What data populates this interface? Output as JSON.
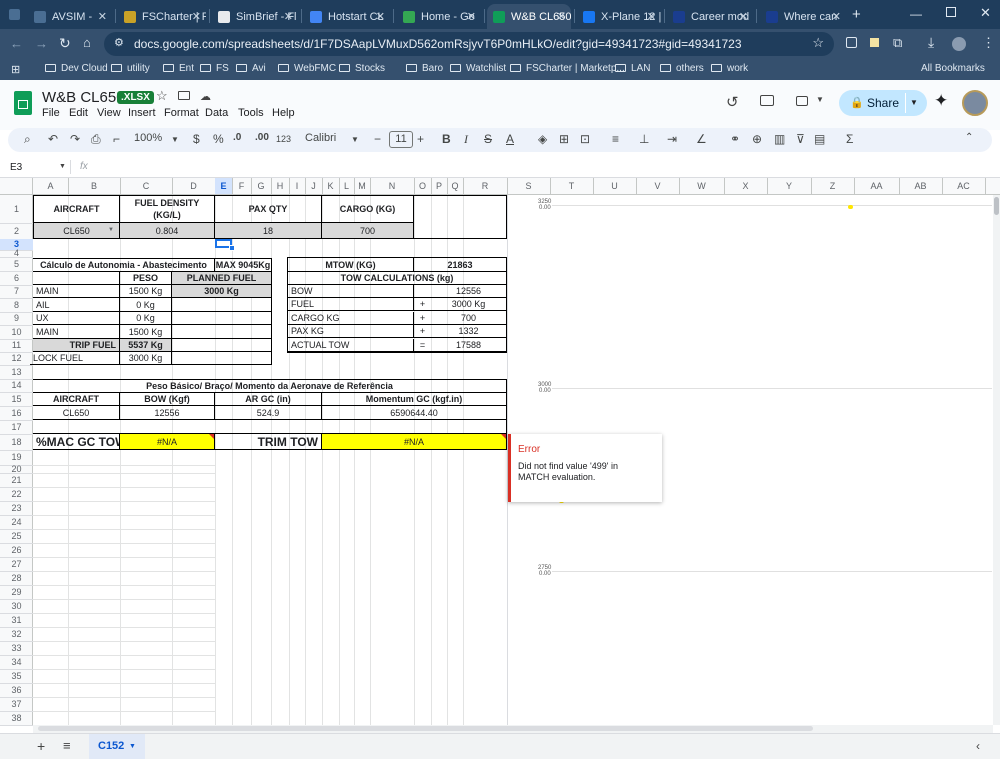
{
  "browser": {
    "tabs": [
      {
        "label": "AVSIM -",
        "color": "#4a6e93",
        "active": false
      },
      {
        "label": "FSCharter | F",
        "color": "#c9a227",
        "active": false
      },
      {
        "label": "SimBrief - Fl",
        "color": "#e8eaed",
        "active": false
      },
      {
        "label": "Hotstart CL",
        "color": "#4285f4",
        "active": false
      },
      {
        "label": "Home - Go",
        "color": "#34a853",
        "active": false
      },
      {
        "label": "W&B CL650",
        "color": "#0f9d58",
        "active": true
      },
      {
        "label": "X-Plane 12 |",
        "color": "#1877f2",
        "active": false
      },
      {
        "label": "Career mod",
        "color": "#1a3d8f",
        "active": false
      },
      {
        "label": "Where can",
        "color": "#1a3d8f",
        "active": false
      }
    ],
    "new_tab": "+",
    "url": "docs.google.com/spreadsheets/d/1F7DSAapLVMuxD562omRsjyvT6P0mHLkO/edit?gid=49341723#gid=49341723",
    "bookmarks": [
      "Dev Cloud",
      "utility",
      "Ent",
      "FS",
      "Avi",
      "WebFMC",
      "Stocks",
      "Baro",
      "Watchlist",
      "FSCharter | Marketp...",
      "LAN",
      "others",
      "work"
    ],
    "all_bookmarks": "All Bookmarks"
  },
  "app": {
    "doc_title": "W&B CL650",
    "badge": ".XLSX",
    "menu": [
      "File",
      "Edit",
      "View",
      "Insert",
      "Format",
      "Data",
      "Tools",
      "Help"
    ],
    "share": "Share"
  },
  "toolbar": {
    "zoom": "100%",
    "currency": "$",
    "percent": "%",
    "dec_less": ".0",
    "dec_more": ".00",
    "format_num": "123",
    "font": "Calibri",
    "font_size": "11"
  },
  "formula": {
    "cell_ref": "E3",
    "fx": "fx"
  },
  "columns": [
    "A",
    "B",
    "C",
    "D",
    "E",
    "F",
    "G",
    "H",
    "I",
    "J",
    "K",
    "L",
    "M",
    "N",
    "O",
    "P",
    "Q",
    "R",
    "S",
    "T",
    "U",
    "V",
    "W",
    "X",
    "Y",
    "Z",
    "AA",
    "AB",
    "AC"
  ],
  "rows": [
    "1",
    "2",
    "3",
    "4",
    "5",
    "6",
    "7",
    "8",
    "9",
    "10",
    "11",
    "12",
    "13",
    "14",
    "15",
    "16",
    "17",
    "18",
    "19",
    "20",
    "21",
    "22",
    "23",
    "24",
    "25",
    "26",
    "27",
    "28",
    "29",
    "30",
    "31",
    "32",
    "33",
    "34",
    "35",
    "36",
    "37",
    "38"
  ],
  "sheet": {
    "aircraft_hdr": "AIRCRAFT",
    "fuel_density_hdr": "FUEL DENSITY (KG/L)",
    "pax_hdr": "PAX QTY",
    "cargo_hdr": "CARGO (KG)",
    "aircraft_val": "CL650",
    "fuel_density_val": "0.804",
    "pax_val": "18",
    "cargo_val": "700",
    "autonomia_title": "Cálculo de Autonomia - Abastecimento",
    "max_label": "MAX 9045Kg",
    "peso_hdr": "PESO",
    "planned_fuel_hdr": "PLANNED FUEL",
    "planned_fuel_val": "3000 Kg",
    "fuel_rows": [
      {
        "label": "MAIN",
        "val": "1500 Kg"
      },
      {
        "label": "AIL",
        "val": "0 Kg"
      },
      {
        "label": "UX",
        "val": "0 Kg"
      },
      {
        "label": "MAIN",
        "val": "1500 Kg"
      }
    ],
    "trip_fuel_label": "TRIP FUEL",
    "trip_fuel_val": "5537 Kg",
    "block_fuel_label": "LOCK FUEL",
    "block_fuel_val": "3000 Kg",
    "mtow_label": "MTOW (KG)",
    "mtow_val": "21863",
    "tow_title": "TOW CALCULATIONS (kg)",
    "tow_rows": [
      {
        "label": "BOW",
        "op": "",
        "val": "12556"
      },
      {
        "label": "FUEL",
        "op": "+",
        "val": "3000 Kg"
      },
      {
        "label": "CARGO KG",
        "op": "+",
        "val": "700"
      },
      {
        "label": "PAX KG",
        "op": "+",
        "val": "1332"
      },
      {
        "label": "ACTUAL TOW",
        "op": "=",
        "val": "17588"
      }
    ],
    "ref_title": "Peso Básico/ Braço/ Momento da Aeronave de Referência",
    "ref_aircraft_hdr": "AIRCRAFT",
    "ref_bow_hdr": "BOW (Kgf)",
    "ref_ar_hdr": "AR GC (in)",
    "ref_mom_hdr": "Momentum GC (kgf.in)",
    "ref_aircraft": "CL650",
    "ref_bow": "12556",
    "ref_ar": "524.9",
    "ref_mom": "6590644.40",
    "mac_label": "%MAC GC TOW",
    "mac_val": "#N/A",
    "trim_label": "TRIM TOW",
    "trim_val": "#N/A"
  },
  "chart": {
    "labels": [
      {
        "top": "3250",
        "bot": "0.00"
      },
      {
        "top": "3000",
        "bot": "0.00"
      },
      {
        "top": "2750",
        "bot": "0.00"
      }
    ]
  },
  "error": {
    "title": "Error",
    "message": "Did not find value '499' in MATCH evaluation."
  },
  "sheet_tab": "C152"
}
